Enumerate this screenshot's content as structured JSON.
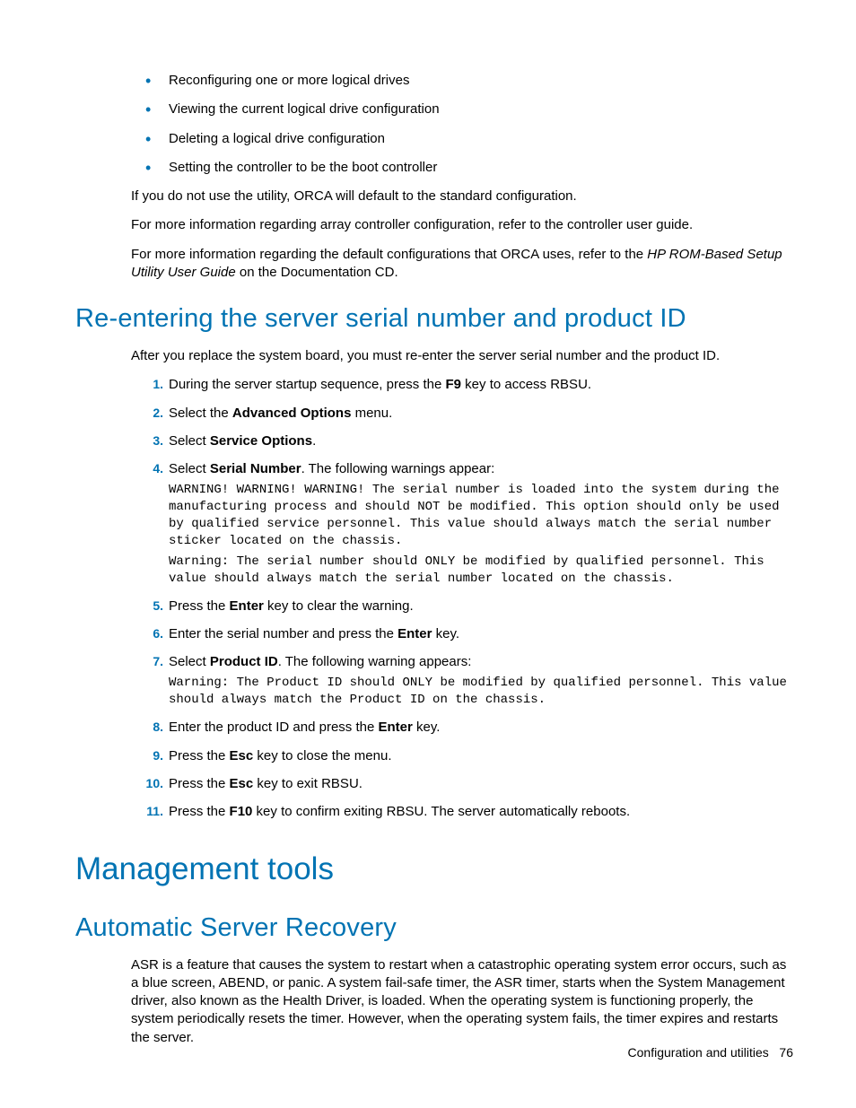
{
  "bullets": [
    "Reconfiguring one or more logical drives",
    "Viewing the current logical drive configuration",
    "Deleting a logical drive configuration",
    "Setting the controller to be the boot controller"
  ],
  "p1": "If you do not use the utility, ORCA will default to the standard configuration.",
  "p2": "For more information regarding array controller configuration, refer to the controller user guide.",
  "p3a": "For more information regarding the default configurations that ORCA uses, refer to the ",
  "p3b": "HP ROM-Based Setup Utility User Guide",
  "p3c": " on the Documentation CD.",
  "h2a": "Re-entering the server serial number and product ID",
  "p4": "After you replace the system board, you must re-enter the server serial number and the product ID.",
  "steps": {
    "s1a": "During the server startup sequence, press the ",
    "s1b": "F9",
    "s1c": " key to access RBSU.",
    "s2a": "Select the ",
    "s2b": "Advanced Options",
    "s2c": " menu.",
    "s3a": "Select ",
    "s3b": "Service Options",
    "s3c": ".",
    "s4a": "Select ",
    "s4b": "Serial Number",
    "s4c": ". The following warnings appear:",
    "s4w1": "WARNING! WARNING! WARNING! The serial number is loaded into the system during the manufacturing process and should NOT be modified. This option should only be used by qualified service personnel. This value should always match the serial number sticker located on the chassis.",
    "s4w2": "Warning: The serial number should ONLY be modified by qualified personnel. This value should always match the serial number located on the chassis.",
    "s5a": "Press the ",
    "s5b": "Enter",
    "s5c": " key to clear the warning.",
    "s6a": "Enter the serial number and press the ",
    "s6b": "Enter",
    "s6c": " key.",
    "s7a": "Select ",
    "s7b": "Product ID",
    "s7c": ". The following warning appears:",
    "s7w": "Warning: The Product ID should ONLY be modified by qualified personnel. This value should always match the Product ID on the chassis.",
    "s8a": "Enter the product ID and press the ",
    "s8b": "Enter",
    "s8c": " key.",
    "s9a": "Press the ",
    "s9b": "Esc",
    "s9c": " key to close the menu.",
    "s10a": "Press the ",
    "s10b": "Esc",
    "s10c": " key to exit RBSU.",
    "s11a": "Press the ",
    "s11b": "F10",
    "s11c": " key to confirm exiting RBSU. The server automatically reboots."
  },
  "h1a": "Management tools",
  "h2b": "Automatic Server Recovery",
  "p5": "ASR is a feature that causes the system to restart when a catastrophic operating system error occurs, such as a blue screen, ABEND, or panic. A system fail-safe timer, the ASR timer, starts when the System Management driver, also known as the Health Driver, is loaded. When the operating system is functioning properly, the system periodically resets the timer. However, when the operating system fails, the timer expires and restarts the server.",
  "footer_section": "Configuration and utilities",
  "footer_page": "76"
}
